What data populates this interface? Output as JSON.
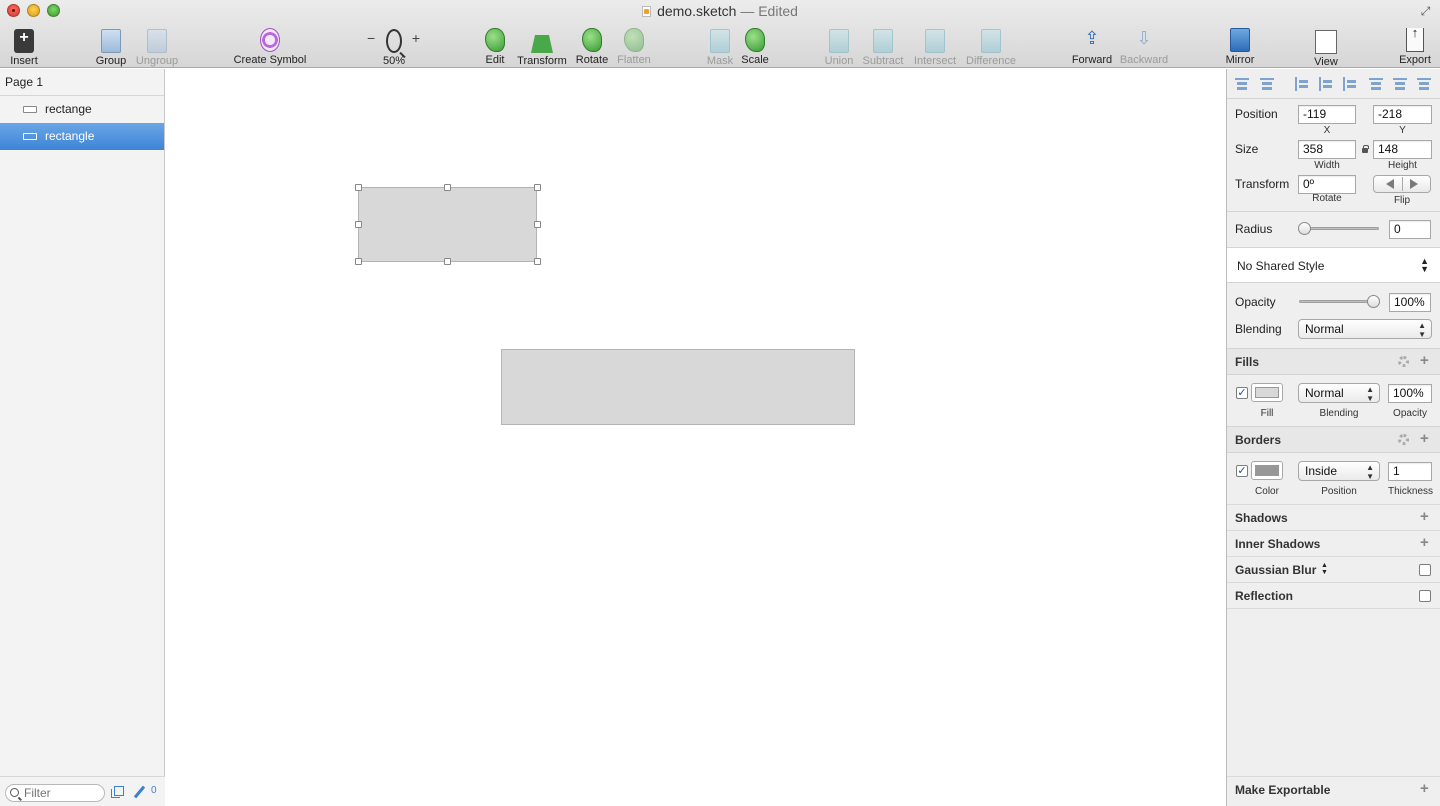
{
  "window": {
    "title": "demo.sketch",
    "status": "— Edited"
  },
  "toolbar": {
    "insert": "Insert",
    "group": "Group",
    "ungroup": "Ungroup",
    "create_symbol": "Create Symbol",
    "zoom_minus": "−",
    "zoom_plus": "+",
    "zoom_level": "50%",
    "edit": "Edit",
    "transform": "Transform",
    "rotate": "Rotate",
    "flatten": "Flatten",
    "mask": "Mask",
    "scale": "Scale",
    "union": "Union",
    "subtract": "Subtract",
    "intersect": "Intersect",
    "difference": "Difference",
    "forward": "Forward",
    "backward": "Backward",
    "mirror": "Mirror",
    "view": "View",
    "export": "Export"
  },
  "sidebar": {
    "page": "Page 1",
    "layers": [
      {
        "name": "rectange",
        "selected": false
      },
      {
        "name": "rectangle",
        "selected": true
      }
    ],
    "filter_placeholder": "Filter",
    "edit_count": "0"
  },
  "inspector": {
    "position_label": "Position",
    "x": "-119",
    "x_label": "X",
    "y": "-218",
    "y_label": "Y",
    "size_label": "Size",
    "width": "358",
    "width_label": "Width",
    "height": "148",
    "height_label": "Height",
    "transform_label": "Transform",
    "rotate": "0º",
    "rotate_label": "Rotate",
    "flip_label": "Flip",
    "radius_label": "Radius",
    "radius": "0",
    "shared_style": "No Shared Style",
    "opacity_label": "Opacity",
    "opacity": "100%",
    "blending_label": "Blending",
    "blending": "Normal",
    "fills": {
      "title": "Fills",
      "enabled": true,
      "color": "#d8d8d8",
      "blending": "Normal",
      "opacity": "100%",
      "fill_label": "Fill",
      "blending_label": "Blending",
      "opacity_label": "Opacity"
    },
    "borders": {
      "title": "Borders",
      "enabled": true,
      "color": "#979797",
      "position": "Inside",
      "thickness": "1",
      "color_label": "Color",
      "position_label": "Position",
      "thickness_label": "Thickness"
    },
    "shadows": "Shadows",
    "inner_shadows": "Inner Shadows",
    "gaussian_blur": "Gaussian Blur",
    "reflection": "Reflection",
    "make_exportable": "Make Exportable"
  }
}
